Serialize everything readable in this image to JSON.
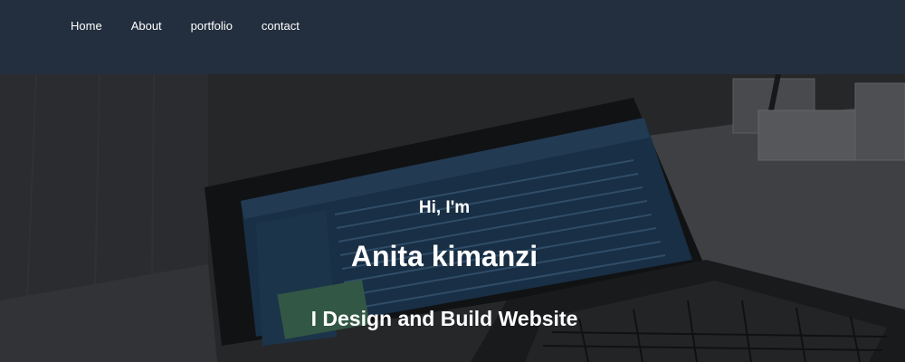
{
  "nav": {
    "items": [
      {
        "label": "Home"
      },
      {
        "label": "About"
      },
      {
        "label": "portfolio"
      },
      {
        "label": "contact"
      }
    ]
  },
  "hero": {
    "greeting": "Hi, I'm",
    "name": "Anita kimanzi",
    "tagline": "I Design and Build Website",
    "background": "laptop-photo"
  },
  "colors": {
    "navbar": "#232f3e",
    "text": "#ffffff"
  }
}
